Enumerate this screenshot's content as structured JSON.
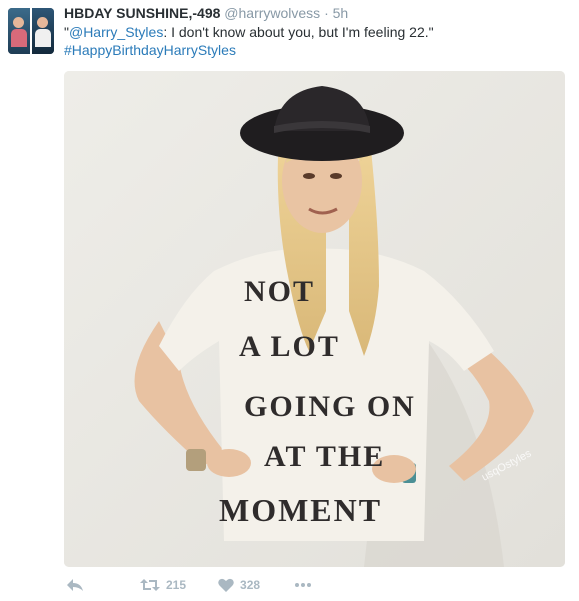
{
  "tweet": {
    "display_name": "HBDAY SUNSHINE,-498",
    "handle": "@harrywolvess",
    "separator": "·",
    "timestamp": "5h",
    "text": {
      "open_quote": "\"",
      "mention": "@Harry_Styles",
      "body": ": I don't know about you, but I'm feeling 22.\"",
      "hashtag": "#HappyBirthdayHarryStyles"
    },
    "image": {
      "shirt_lines": [
        "NOT",
        "A LOT",
        "GOING ON",
        "AT THE",
        "MOMENT"
      ],
      "watermark": "usqOstyles"
    },
    "actions": {
      "reply_icon": "reply-icon",
      "retweet_icon": "retweet-icon",
      "retweet_count": "215",
      "like_icon": "heart-icon",
      "like_count": "328",
      "more_icon": "more-dots-icon"
    }
  },
  "colors": {
    "link": "#2b7bb9",
    "name": "#292f33",
    "muted": "#8899a6",
    "action": "#aab8c2"
  }
}
